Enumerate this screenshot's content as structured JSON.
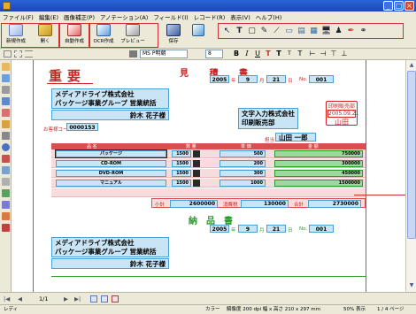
{
  "window": {
    "title": "",
    "minimize": "_",
    "maximize": "□",
    "close": "×"
  },
  "menu": [
    "ファイル(F)",
    "編集(E)",
    "画像補正(P)",
    "アノテーション(A)",
    "フィールド(I)",
    "レコード(R)",
    "表示(V)",
    "ヘルプ(H)"
  ],
  "toolbar": {
    "buttons": [
      "新規作成",
      "開く",
      "自動作成",
      "OCR作成",
      "プレビュー",
      "保存"
    ],
    "icons": [
      "new-icon",
      "open-icon",
      "auto-create-icon",
      "ocr-icon",
      "preview-icon",
      "save-icon"
    ],
    "draw_tools": [
      "↖",
      "T",
      "▢",
      "✎",
      "⟋",
      "▭",
      "▤",
      "▦",
      "🖥",
      "♟",
      "✒",
      "⚭"
    ]
  },
  "format_bar": {
    "font": "MS P明朝",
    "size": "8",
    "buttons": [
      "B",
      "I",
      "U",
      "T",
      "T",
      "T",
      "T",
      "⊢",
      "⊣",
      "⊤",
      "⊥"
    ]
  },
  "doc1": {
    "title": "重要",
    "date_year": "2005",
    "date_month": "9",
    "date_day": "21",
    "unit_year": "年",
    "unit_month": "月",
    "unit_day": "日",
    "no_label": "No.",
    "number": "001",
    "company_line1": "メディアドライブ株式会社",
    "company_line2": "パッケージ事業グループ 営業統括",
    "person": "鈴木 花子様",
    "customer_code_label": "お客様コード",
    "customer_code": "0000153",
    "sender_line1": "文字入力株式会社",
    "sender_line2": "印刷販売部",
    "stamp_top": "印刷販売部",
    "stamp_date": "2005.09.21",
    "stamp_name": "山田",
    "rep_label": "担当",
    "rep_name": "山田 一郎",
    "table_headers": [
      "品 名",
      "数 量",
      "単 価",
      "金 額"
    ],
    "items": [
      {
        "name": "パッケージ",
        "qty": "1500",
        "price": "500",
        "amount": "750000"
      },
      {
        "name": "CD-ROM",
        "qty": "1500",
        "price": "200",
        "amount": "300000"
      },
      {
        "name": "DVD-ROM",
        "qty": "1500",
        "price": "300",
        "amount": "450000"
      },
      {
        "name": "マニュアル",
        "qty": "1500",
        "price": "1000",
        "amount": "1500000"
      }
    ],
    "subtotal_label": "小計",
    "subtotal": "2600000",
    "tax_label": "消費税",
    "tax": "130000",
    "total_label": "合計",
    "total": "2730000"
  },
  "doc2": {
    "title": "納品書",
    "date_year": "2005",
    "date_month": "9",
    "date_day": "21",
    "unit_year": "年",
    "unit_month": "月",
    "unit_day": "日",
    "no_label": "No.",
    "number": "001",
    "company_line1": "メディアドライブ株式会社",
    "company_line2": "パッケージ事業グループ 営業統括",
    "person": "鈴木 花子様"
  },
  "nav": {
    "page": "1/1"
  },
  "status": {
    "left": "レディ",
    "color": "カラー",
    "resolution": "解像度 200 dpi 幅 x 高さ 210 x 297 mm",
    "zoom": "50% 表示",
    "page": "1 / 4 ページ"
  },
  "colors": {
    "accent_red": "#d02020",
    "field_blue": "#c9e4f4",
    "field_green": "#2a9a2a",
    "titlebar": "#2a63d8"
  }
}
